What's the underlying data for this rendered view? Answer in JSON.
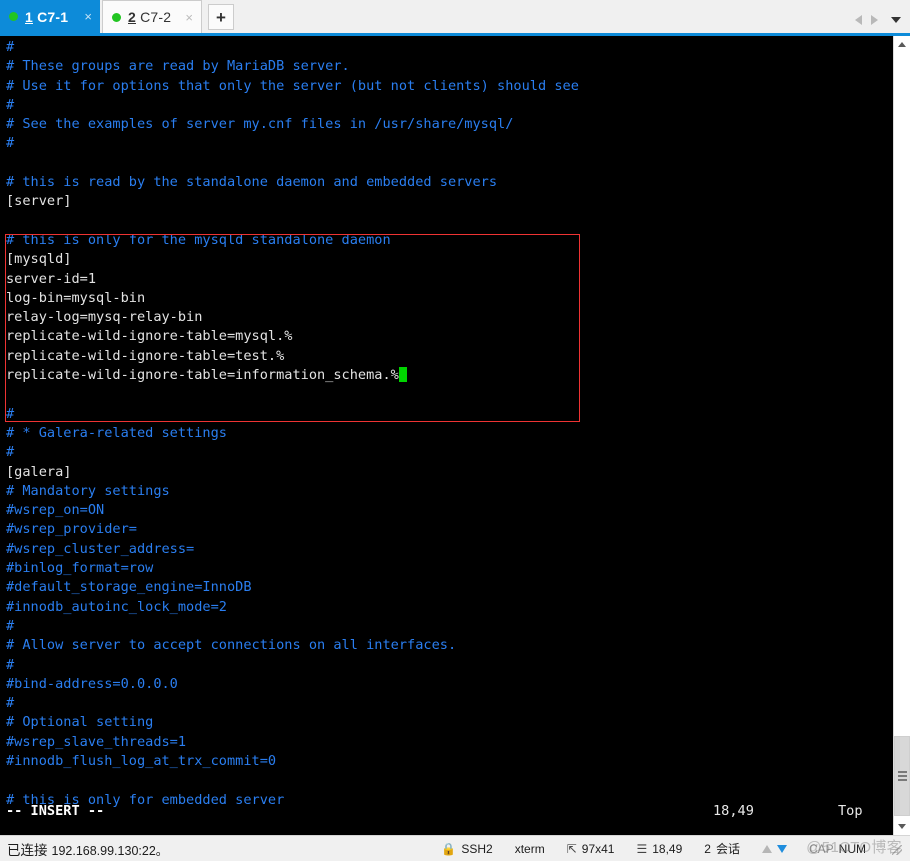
{
  "tabs": [
    {
      "index": "1",
      "mnemonic": "1",
      "label": " C7-1",
      "close": "×",
      "active": true,
      "status_dot": "connected-dot"
    },
    {
      "index": "2",
      "mnemonic": "2",
      "label": " C7-2",
      "close": "×",
      "active": false,
      "status_dot": "connected-dot"
    }
  ],
  "tabbar": {
    "new_tab_label": "+",
    "nav_prev_icon": "triangle-left-icon",
    "nav_next_icon": "triangle-right-icon",
    "nav_menu_icon": "chevron-down-icon"
  },
  "terminal": {
    "lines": [
      {
        "text": "#",
        "color": "comment"
      },
      {
        "text": "# These groups are read by MariaDB server.",
        "color": "comment"
      },
      {
        "text": "# Use it for options that only the server (but not clients) should see",
        "color": "comment"
      },
      {
        "text": "#",
        "color": "comment"
      },
      {
        "text": "# See the examples of server my.cnf files in /usr/share/mysql/",
        "color": "comment"
      },
      {
        "text": "#",
        "color": "comment"
      },
      {
        "text": "",
        "color": "comment"
      },
      {
        "text": "# this is read by the standalone daemon and embedded servers",
        "color": "comment"
      },
      {
        "text": "[server]",
        "color": "plain"
      },
      {
        "text": "",
        "color": "plain"
      },
      {
        "text": "# this is only for the mysqld standalone daemon",
        "color": "comment"
      },
      {
        "text": "[mysqld]",
        "color": "plain"
      },
      {
        "text": "server-id=1",
        "color": "plain"
      },
      {
        "text": "log-bin=mysql-bin",
        "color": "plain"
      },
      {
        "text": "relay-log=mysq-relay-bin",
        "color": "plain"
      },
      {
        "text": "replicate-wild-ignore-table=mysql.%",
        "color": "plain"
      },
      {
        "text": "replicate-wild-ignore-table=test.%",
        "color": "plain"
      },
      {
        "text": "replicate-wild-ignore-table=information_schema.%",
        "color": "plain",
        "cursor": true
      },
      {
        "text": "",
        "color": "plain"
      },
      {
        "text": "#",
        "color": "comment"
      },
      {
        "text": "# * Galera-related settings",
        "color": "comment"
      },
      {
        "text": "#",
        "color": "comment"
      },
      {
        "text": "[galera]",
        "color": "plain"
      },
      {
        "text": "# Mandatory settings",
        "color": "comment"
      },
      {
        "text": "#wsrep_on=ON",
        "color": "comment"
      },
      {
        "text": "#wsrep_provider=",
        "color": "comment"
      },
      {
        "text": "#wsrep_cluster_address=",
        "color": "comment"
      },
      {
        "text": "#binlog_format=row",
        "color": "comment"
      },
      {
        "text": "#default_storage_engine=InnoDB",
        "color": "comment"
      },
      {
        "text": "#innodb_autoinc_lock_mode=2",
        "color": "comment"
      },
      {
        "text": "#",
        "color": "comment"
      },
      {
        "text": "# Allow server to accept connections on all interfaces.",
        "color": "comment"
      },
      {
        "text": "#",
        "color": "comment"
      },
      {
        "text": "#bind-address=0.0.0.0",
        "color": "comment"
      },
      {
        "text": "#",
        "color": "comment"
      },
      {
        "text": "# Optional setting",
        "color": "comment"
      },
      {
        "text": "#wsrep_slave_threads=1",
        "color": "comment"
      },
      {
        "text": "#innodb_flush_log_at_trx_commit=0",
        "color": "comment"
      },
      {
        "text": "",
        "color": "comment"
      },
      {
        "text": "# this is only for embedded server",
        "color": "comment"
      }
    ],
    "vim_status": {
      "mode": "-- INSERT --",
      "position": "18,49",
      "scroll": "Top"
    },
    "highlight_box_color": "#ee3333"
  },
  "scrollbar": {
    "up_icon": "chevron-up-icon",
    "down_icon": "chevron-down-icon",
    "thumb_icon": "scroll-thumb-grip"
  },
  "statusbar": {
    "connection_state": "已连接",
    "connection_address": "192.168.99.130:22。",
    "lock_icon": "lock-icon",
    "protocol": "SSH2",
    "terminal_type": "xterm",
    "size_icon": "resize-icon",
    "size": "97x41",
    "cursor_icon": "column-icon",
    "cursor_position": "18,49",
    "sessions_count": "2",
    "sessions_label": "会话",
    "upload_icon": "arrow-up-icon",
    "download_icon": "arrow-down-icon",
    "caps_lock": "CAP",
    "num_lock": "NUM",
    "watermark": "@51CTO博客",
    "resize_grip_icon": "resize-grip-icon"
  }
}
